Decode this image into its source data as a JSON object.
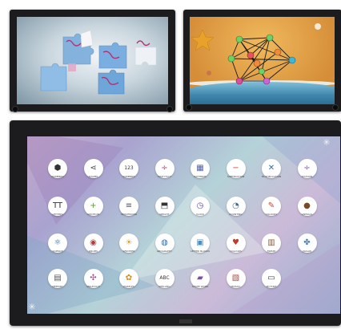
{
  "screens": {
    "puzzle": {
      "title": ""
    },
    "constellation": {
      "title": ""
    },
    "launcher": {
      "apps": [
        {
          "label": "NUMBERS",
          "icon": "puzzle-icon",
          "glyph": "⬢",
          "color": "#333333"
        },
        {
          "label": "SHAPES",
          "icon": "share-icon",
          "glyph": "⋖",
          "color": "#4b4b4b"
        },
        {
          "label": "NUMBERS",
          "icon": "digits-icon",
          "glyph": "123",
          "color": "#333333"
        },
        {
          "label": "MATH FACT",
          "icon": "math-icon",
          "glyph": "÷",
          "color": "#b2375b"
        },
        {
          "label": "PATTERNS",
          "icon": "grid-icon",
          "glyph": "▦",
          "color": "#4f5fa3"
        },
        {
          "label": "SUBTRACTION",
          "icon": "minus-icon",
          "glyph": "−",
          "color": "#c94747"
        },
        {
          "label": "MULTIPLICATION",
          "icon": "times-icon",
          "glyph": "✕",
          "color": "#2f6db3"
        },
        {
          "label": "DIVISION",
          "icon": "divide-icon",
          "glyph": "÷",
          "color": "#7a4da8"
        },
        {
          "label": "LETTERS",
          "icon": "text-icon",
          "glyph": "TT",
          "color": "#333333"
        },
        {
          "label": "ADDITION",
          "icon": "plus-icon",
          "glyph": "+",
          "color": "#5a9b3c"
        },
        {
          "label": "SEQUENCING",
          "icon": "sequence-icon",
          "glyph": "≡",
          "color": "#555555"
        },
        {
          "label": "WEIGHT",
          "icon": "weight-icon",
          "glyph": "⬒",
          "color": "#333333"
        },
        {
          "label": "CLOCK",
          "icon": "clock-icon",
          "glyph": "◷",
          "color": "#5a4c9e"
        },
        {
          "label": "COUNTING",
          "icon": "cycle-icon",
          "glyph": "◔",
          "color": "#3b6e96"
        },
        {
          "label": "COLOURS",
          "icon": "brush-icon",
          "glyph": "✎",
          "color": "#c2452f"
        },
        {
          "label": "ANIMALS",
          "icon": "animal-icon",
          "glyph": "●",
          "color": "#7a4a25"
        },
        {
          "label": "SCIENCE",
          "icon": "atom-icon",
          "glyph": "⚛",
          "color": "#2f6b9e"
        },
        {
          "label": "DRUMS",
          "icon": "drum-icon",
          "glyph": "◉",
          "color": "#b23b3b"
        },
        {
          "label": "WEATHER",
          "icon": "sun-icon",
          "glyph": "☀",
          "color": "#e0a21e"
        },
        {
          "label": "GEOGRAPHY",
          "icon": "globe-icon",
          "glyph": "◍",
          "color": "#2f6db3"
        },
        {
          "label": "LETTER BLOCKS",
          "icon": "blocks-icon",
          "glyph": "▣",
          "color": "#4a8ec2"
        },
        {
          "label": "COLOURS",
          "icon": "heart-icon",
          "glyph": "♥",
          "color": "#c0392b"
        },
        {
          "label": "FRIEZE",
          "icon": "frieze-icon",
          "glyph": "▥",
          "color": "#8a5a3a"
        },
        {
          "label": "JIGSAW",
          "icon": "jigsaw-icon",
          "glyph": "✤",
          "color": "#3f7fc0"
        },
        {
          "label": "MEMORY",
          "icon": "cards-icon",
          "glyph": "▤",
          "color": "#555555"
        },
        {
          "label": "MOLECULE",
          "icon": "molecule-icon",
          "glyph": "✣",
          "color": "#a34c86"
        },
        {
          "label": "PUZZLES",
          "icon": "gear-icon",
          "glyph": "✿",
          "color": "#d68a1e"
        },
        {
          "label": "SPELLING",
          "icon": "abc-icon",
          "glyph": "ABC",
          "color": "#333333"
        },
        {
          "label": "SHAPE WORD",
          "icon": "shape-word-icon",
          "glyph": "▰",
          "color": "#7a4da8"
        },
        {
          "label": "MOSAIC",
          "icon": "mosaic-icon",
          "glyph": "▧",
          "color": "#c2452f"
        },
        {
          "label": "PICTURE",
          "icon": "picture-icon",
          "glyph": "▭",
          "color": "#444444"
        }
      ]
    }
  },
  "bolt_glyph": "✳"
}
